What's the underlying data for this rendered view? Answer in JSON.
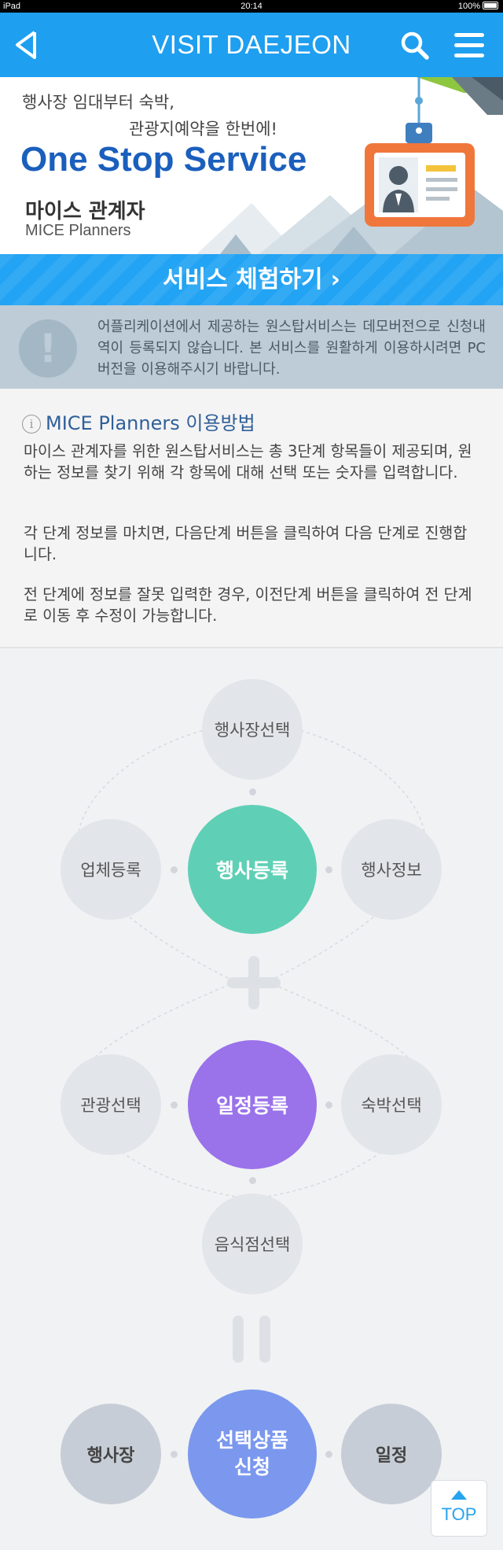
{
  "status_bar": {
    "device": "iPad",
    "time": "20:14",
    "battery": "100%"
  },
  "header": {
    "title": "VISIT DAEJEON"
  },
  "hero": {
    "line1": "행사장 임대부터 숙박,",
    "line2": "관광지예약을 한번에!",
    "service": "One Stop Service",
    "role_ko": "마이스 관계자",
    "role_en": "MICE Planners"
  },
  "cta": {
    "label": "서비스 체험하기",
    "chevron": "›"
  },
  "notice": {
    "icon": "!",
    "text": "어플리케이션에서 제공하는 원스탑서비스는 데모버전으로 신청내역이 등록되지 않습니다. 본 서비스를 원활하게 이용하시려면 PC버전을 이용해주시기 바랍니다."
  },
  "howto": {
    "info_icon": "i",
    "title": "MICE Planners 이용방법",
    "p1": "마이스 관계자를 위한 원스탑서비스는 총 3단계 항목들이 제공되며, 원하는 정보를 찾기 위해 각 항목에 대해 선택 또는 숫자를 입력합니다.",
    "p2": "각 단계 정보를 마치면, 다음단계 버튼을 클릭하여 다음 단계로 진행합니다.",
    "p3": "전 단계에 정보를 잘못 입력한 경우, 이전단계 버튼을 클릭하여 전 단계로 이동 후 수정이 가능합니다."
  },
  "diagram": {
    "step1": {
      "main": "행사등록",
      "top": "행사장선택",
      "left": "업체등록",
      "right": "행사정보"
    },
    "step2": {
      "main": "일정등록",
      "left": "관광선택",
      "right": "숙박선택",
      "bottom": "음식점선택"
    },
    "step3": {
      "main_line1": "선택상품",
      "main_line2": "신청",
      "left": "행사장",
      "right": "일정"
    }
  },
  "top_button": {
    "label": "TOP"
  },
  "colors": {
    "header": "#1e9ff0",
    "brand_blue": "#1b5fbd",
    "step1_main": "#5fd0b5",
    "step2_main": "#9a72ea",
    "step3_main": "#7b98ee",
    "notice_bg": "#bdccd6"
  }
}
